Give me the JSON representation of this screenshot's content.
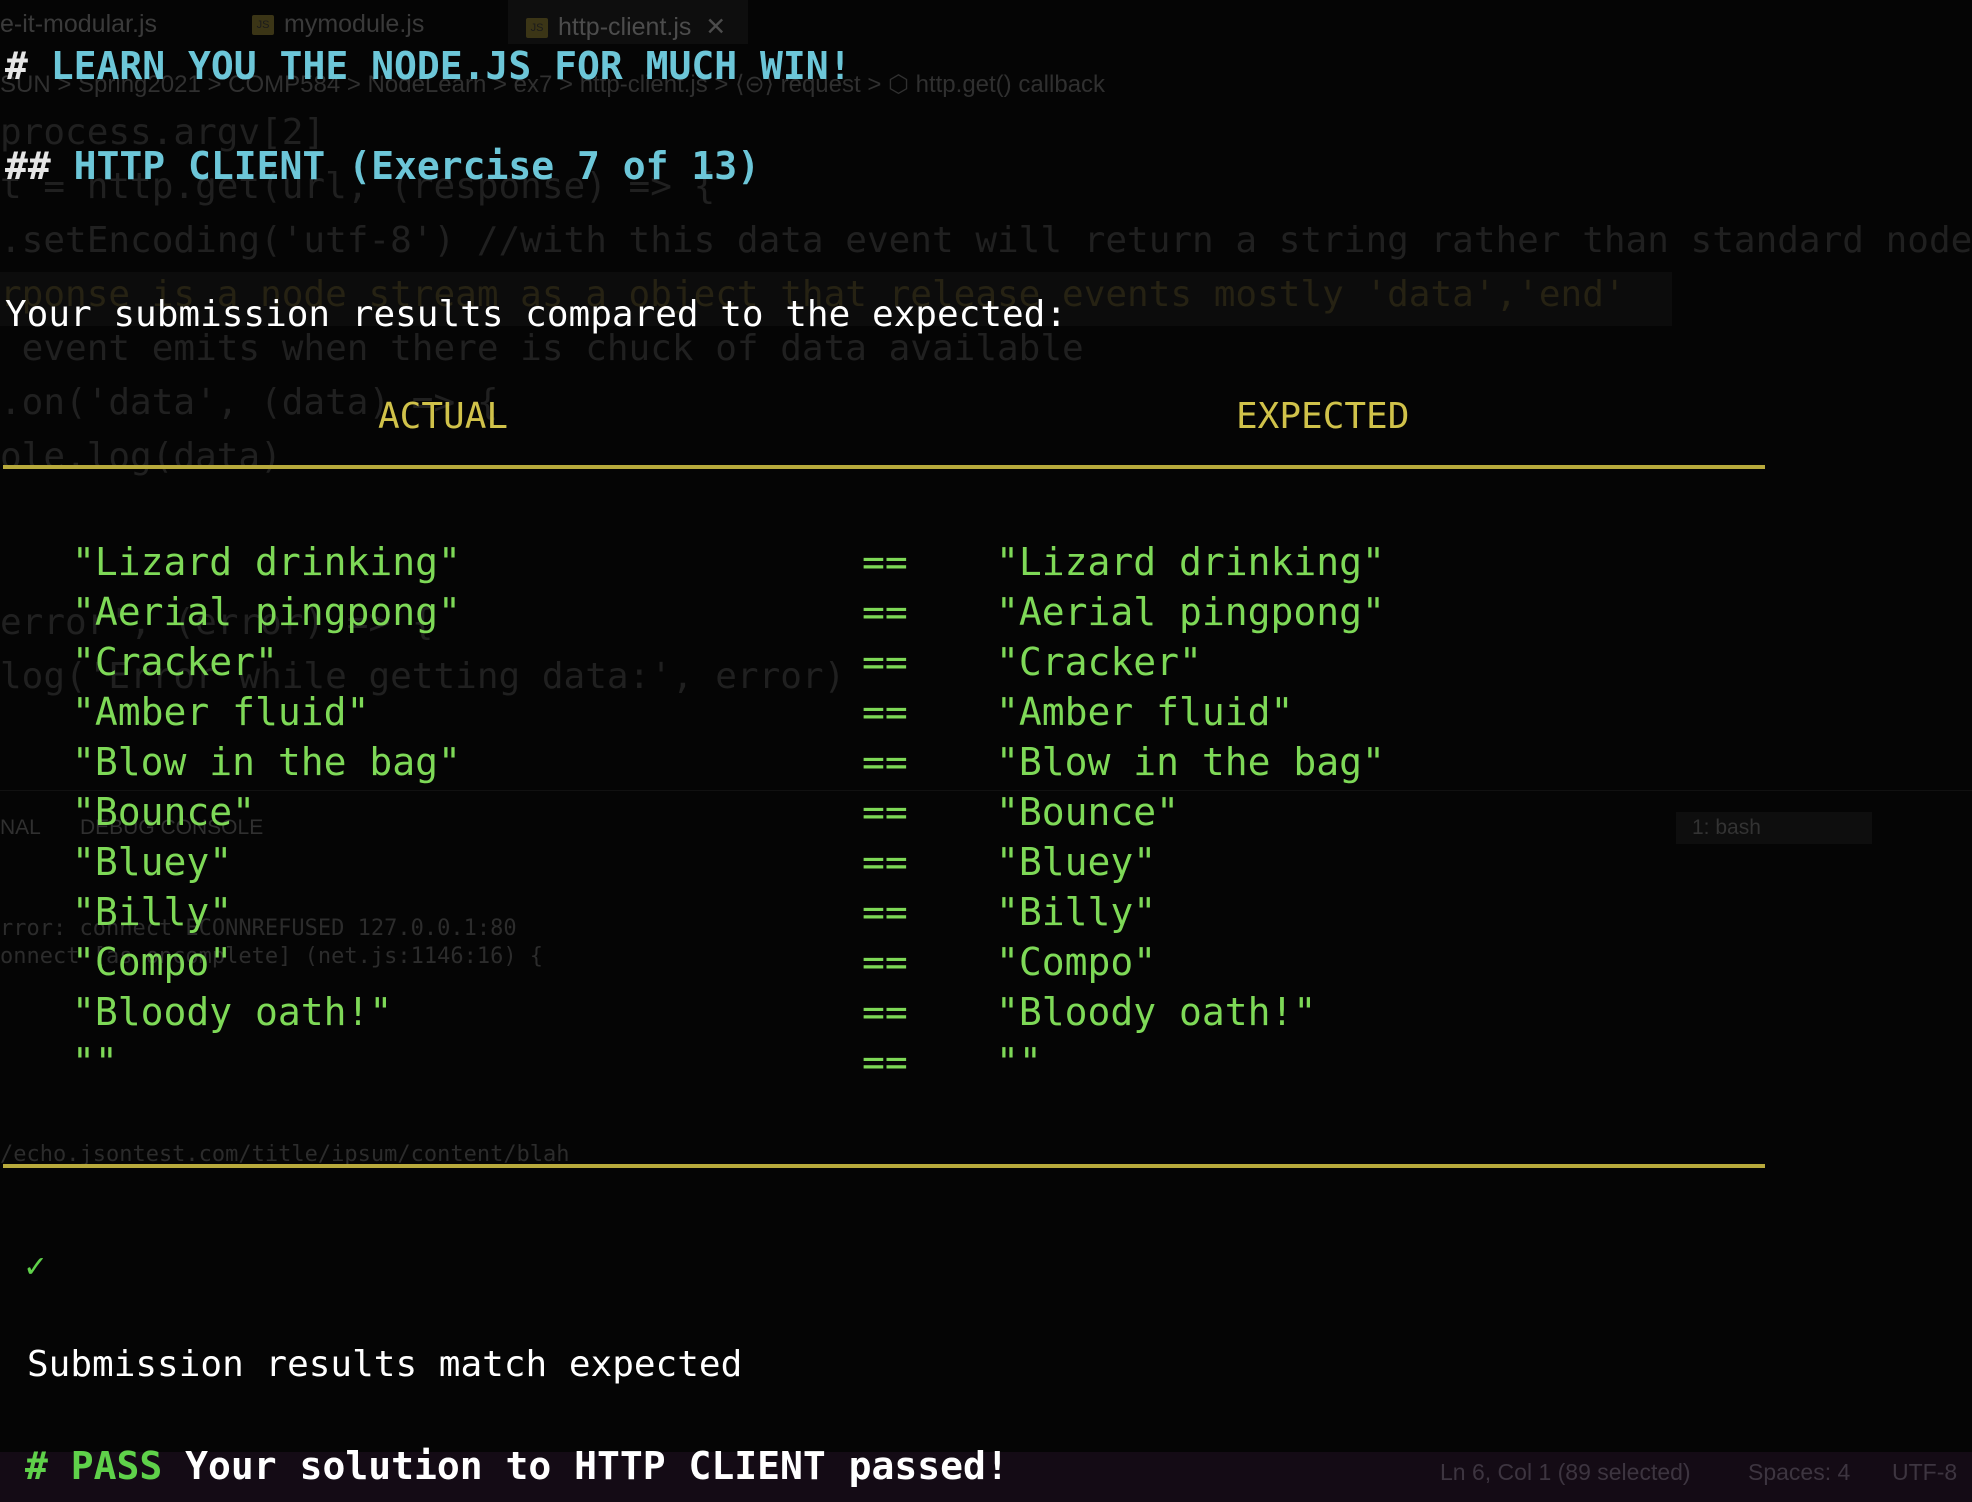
{
  "background_editor": {
    "tabs": [
      {
        "label": "e-it-modular.js"
      },
      {
        "label": "mymodule.js"
      },
      {
        "label": "http-client.js"
      }
    ],
    "close_glyph": "✕",
    "breadcrumb": "SUN > Spring2021 > COMP584 > NodeLearn > ex7 > http-client.js > ⟨⊝⟩ request > ⬡ http.get() callback",
    "code_lines": [
      "process.argv[2]",
      "t = http.get(url, (response) => {",
      ".setEncoding('utf-8') //with this data event will return a string rather than standard node",
      "rponse is a node stream as a object that release events mostly 'data','end'",
      " event emits when there is chuck of data available",
      ".on('data', (data) => {",
      "ole.log(data)",
      "error', (error) => {",
      "log('Error while getting data:', error)"
    ],
    "panel_tabs": [
      "NAL",
      "DEBUG CONSOLE"
    ],
    "terminal_select": "1: bash",
    "terminal_lines": [
      "rror: connect ECONNREFUSED 127.0.0.1:80",
      "onnect [as oncomplete] (net.js:1146:16) {",
      "/echo.jsontest.com/title/ipsum/content/blah"
    ],
    "statusbar": {
      "position": "Ln 6, Col 1 (89 selected)",
      "spaces": "Spaces: 4",
      "encoding": "UTF-8"
    }
  },
  "terminal": {
    "title_hash": "#",
    "title": "LEARN YOU THE NODE.JS FOR MUCH WIN!",
    "subtitle_hash": "##",
    "subtitle": "HTTP CLIENT (Exercise 7 of 13)",
    "intro": "Your submission results compared to the expected:",
    "actual_header": "ACTUAL",
    "expected_header": "EXPECTED",
    "rows": [
      {
        "actual": "\"Lizard drinking\"",
        "op": "==",
        "expected": "\"Lizard drinking\""
      },
      {
        "actual": "\"Aerial pingpong\"",
        "op": "==",
        "expected": "\"Aerial pingpong\""
      },
      {
        "actual": "\"Cracker\"",
        "op": "==",
        "expected": "\"Cracker\""
      },
      {
        "actual": "\"Amber fluid\"",
        "op": "==",
        "expected": "\"Amber fluid\""
      },
      {
        "actual": "\"Blow in the bag\"",
        "op": "==",
        "expected": "\"Blow in the bag\""
      },
      {
        "actual": "\"Bounce\"",
        "op": "==",
        "expected": "\"Bounce\""
      },
      {
        "actual": "\"Bluey\"",
        "op": "==",
        "expected": "\"Bluey\""
      },
      {
        "actual": "\"Billy\"",
        "op": "==",
        "expected": "\"Billy\""
      },
      {
        "actual": "\"Compo\"",
        "op": "==",
        "expected": "\"Compo\""
      },
      {
        "actual": "\"Bloody oath!\"",
        "op": "==",
        "expected": "\"Bloody oath!\""
      },
      {
        "actual": "\"\"",
        "op": "==",
        "expected": "\"\""
      }
    ],
    "check_mark": "✓",
    "match_message": "Submission results match expected",
    "pass_prefix": "# PASS",
    "pass_message": "Your solution to HTTP CLIENT passed!"
  },
  "colors": {
    "header_cyan": "#6cc6d8",
    "column_yellow": "#d0c24a",
    "value_green": "#7ed957",
    "statusbar_purple": "#140b15"
  }
}
